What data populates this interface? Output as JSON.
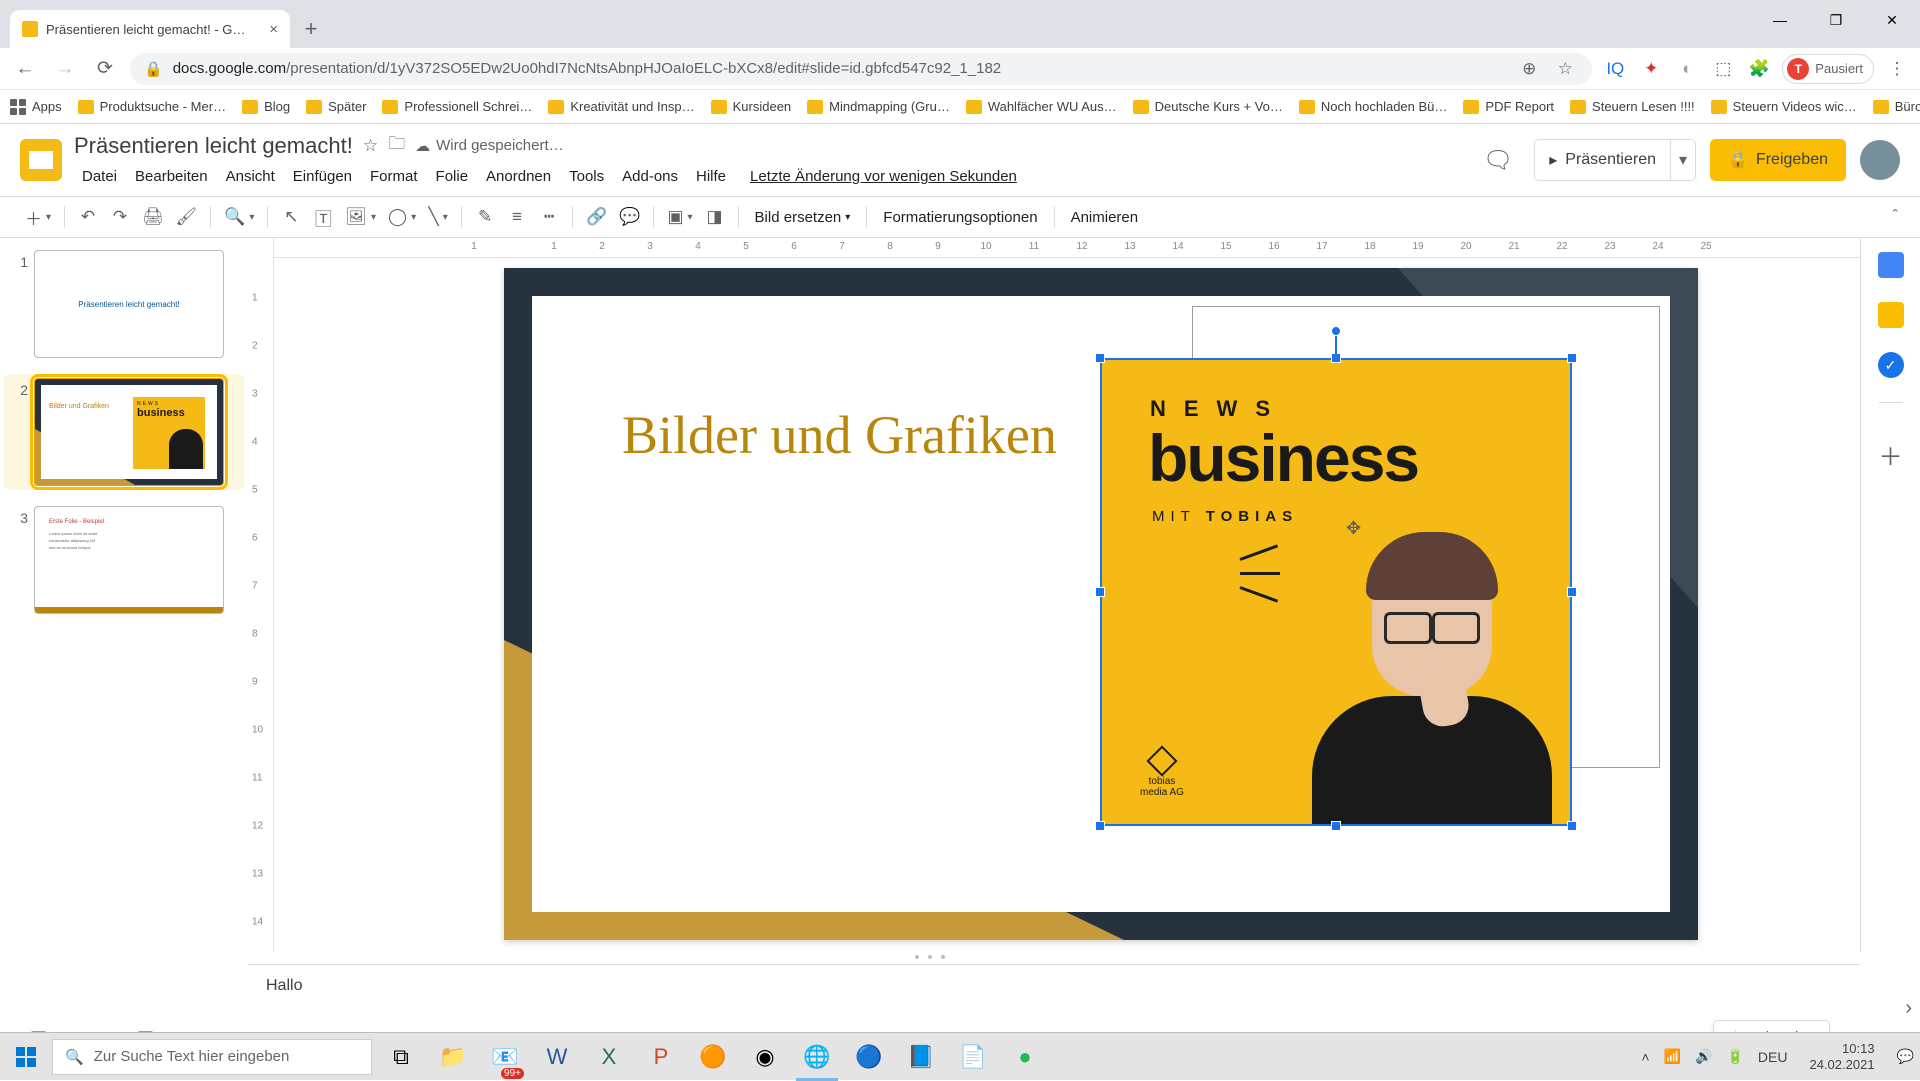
{
  "browser": {
    "tab_title": "Präsentieren leicht gemacht! - G…",
    "url_prefix": "docs.google.com",
    "url_rest": "/presentation/d/1yV372SO5EDw2Uo0hdI7NcNtsAbnpHJOaIoELC-bXCx8/edit#slide=id.gbfcd547c92_1_182",
    "profile_state": "Pausiert",
    "profile_initial": "T"
  },
  "bookmarks": [
    "Apps",
    "Produktsuche - Mer…",
    "Blog",
    "Später",
    "Professionell Schrei…",
    "Kreativität und Insp…",
    "Kursideen",
    "Mindmapping  (Gru…",
    "Wahlfächer WU Aus…",
    "Deutsche Kurs + Vo…",
    "Noch hochladen Bü…",
    "PDF Report",
    "Steuern Lesen !!!!",
    "Steuern Videos wic…",
    "Büro"
  ],
  "doc": {
    "title": "Präsentieren leicht gemacht!",
    "saving": "Wird gespeichert…",
    "last_edit": "Letzte Änderung vor wenigen Sekunden"
  },
  "menubar": [
    "Datei",
    "Bearbeiten",
    "Ansicht",
    "Einfügen",
    "Format",
    "Folie",
    "Anordnen",
    "Tools",
    "Add-ons",
    "Hilfe"
  ],
  "header_actions": {
    "present": "Präsentieren",
    "share": "Freigeben"
  },
  "toolbar": {
    "replace_image": "Bild ersetzen",
    "format_options": "Formatierungsoptionen",
    "animate": "Animieren"
  },
  "hruler_ticks": [
    "1",
    "1",
    "2",
    "3",
    "4",
    "5",
    "6",
    "7",
    "8",
    "9",
    "10",
    "11",
    "12",
    "13",
    "14",
    "15",
    "16",
    "17",
    "18",
    "19",
    "20",
    "21",
    "22",
    "23",
    "24",
    "25"
  ],
  "vruler_ticks": [
    "1",
    "2",
    "3",
    "4",
    "5",
    "6",
    "7",
    "8",
    "9",
    "10",
    "11",
    "12",
    "13",
    "14"
  ],
  "thumbs": {
    "1": {
      "title": "Präsentieren leicht gemacht!"
    },
    "2": {
      "title": "Bilder und Grafiken"
    },
    "3": {
      "title": "Erste Folie - Beispiel",
      "line": "…"
    }
  },
  "slide": {
    "heading": "Bilder und Grafiken",
    "image": {
      "news": "NEWS",
      "business": "business",
      "mit_prefix": "MIT ",
      "mit_name": "TOBIAS",
      "brand": "tobias\nmedia AG"
    }
  },
  "notes": "Hallo",
  "explore": "Erkunden",
  "taskbar": {
    "search_placeholder": "Zur Suche Text hier eingeben",
    "lang": "DEU",
    "time": "10:13",
    "date": "24.02.2021",
    "notif_badge": "99+"
  }
}
